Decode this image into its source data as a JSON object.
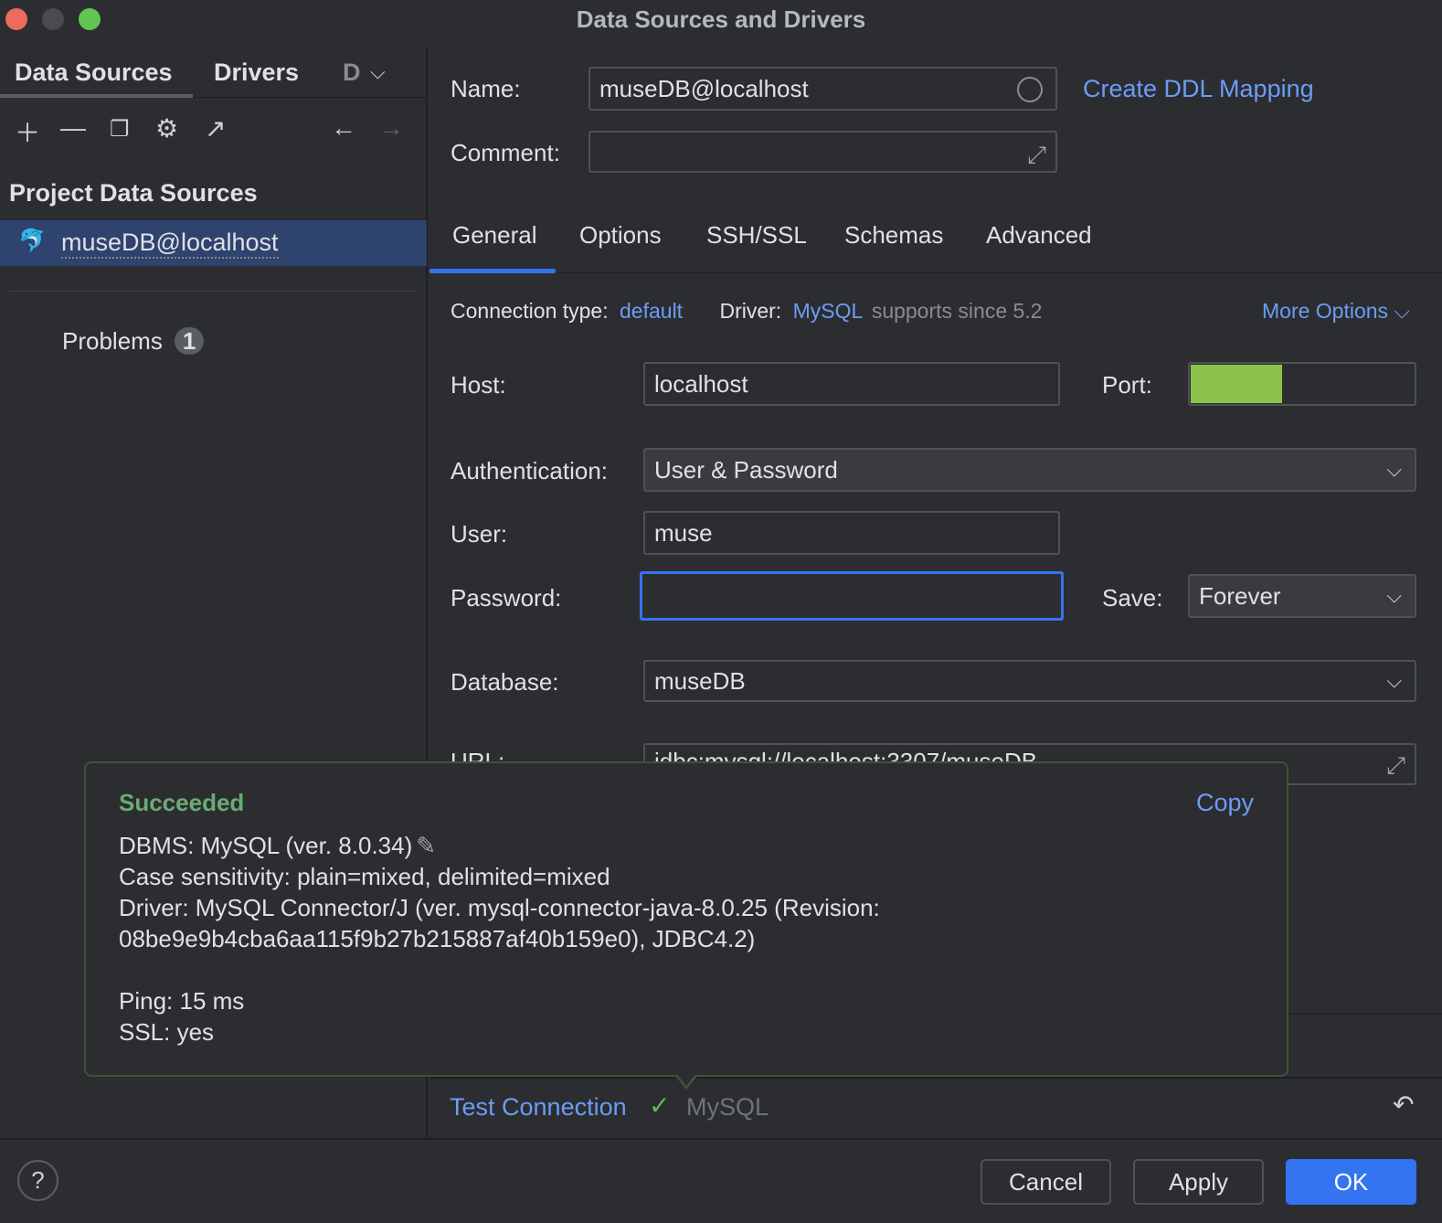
{
  "window": {
    "title": "Data Sources and Drivers"
  },
  "left": {
    "tabs": [
      "Data Sources",
      "Drivers",
      "D"
    ],
    "section": "Project Data Sources",
    "selected_item": "museDB@localhost",
    "problems_label": "Problems",
    "problems_count": "1"
  },
  "form": {
    "name_label": "Name:",
    "name_value": "museDB@localhost",
    "create_ddl": "Create DDL Mapping",
    "comment_label": "Comment:",
    "comment_value": "",
    "tabs": [
      "General",
      "Options",
      "SSH/SSL",
      "Schemas",
      "Advanced"
    ],
    "active_tab": "General",
    "conn_type_label": "Connection type:",
    "conn_type_value": "default",
    "driver_label": "Driver:",
    "driver_value": "MySQL",
    "driver_note": "supports since 5.2",
    "more_options": "More Options",
    "host_label": "Host:",
    "host_value": "localhost",
    "port_label": "Port:",
    "port_redaction_color": "#8bc34a",
    "auth_label": "Authentication:",
    "auth_value": "User & Password",
    "user_label": "User:",
    "user_value": "muse",
    "password_label": "Password:",
    "password_value": "",
    "save_label": "Save:",
    "save_value": "Forever",
    "database_label": "Database:",
    "database_value": "museDB",
    "url_label": "URL:",
    "url_value": "jdbc:mysql://localhost:3307/museDB"
  },
  "popup": {
    "status": "Succeeded",
    "copy": "Copy",
    "lines": [
      "DBMS: MySQL (ver. 8.0.34)",
      "Case sensitivity: plain=mixed, delimited=mixed",
      "Driver: MySQL Connector/J (ver. mysql-connector-java-8.0.25 (Revision:",
      "08be9e9b4cba6aa115f9b27b215887af40b159e0), JDBC4.2)",
      "",
      "Ping: 15 ms",
      "SSL: yes"
    ]
  },
  "bottom": {
    "test_connection": "Test Connection",
    "test_driver": "MySQL",
    "cancel": "Cancel",
    "apply": "Apply",
    "ok": "OK",
    "help": "?"
  },
  "colors": {
    "accent": "#3574f0",
    "link": "#6d9cf6",
    "success": "#5fb75f",
    "selection": "#2e436e"
  }
}
